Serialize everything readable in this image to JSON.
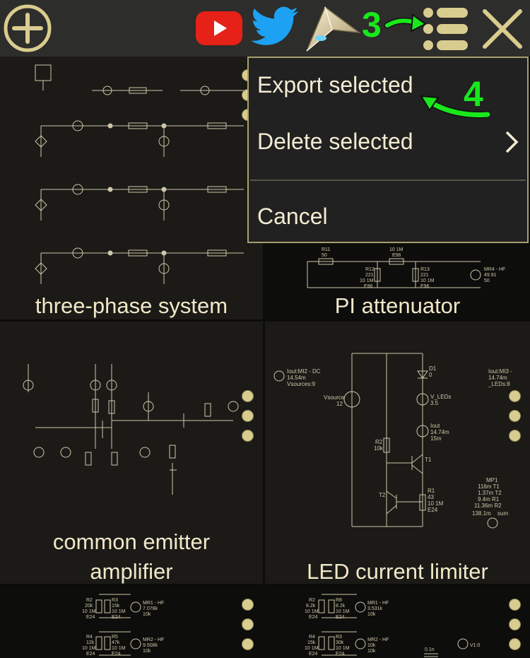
{
  "toolbar": {
    "add_icon": "plus-circle-icon",
    "youtube_icon": "youtube-icon",
    "twitter_icon": "twitter-icon",
    "app_icon": "app-logo-icon",
    "menu_icon": "list-menu-icon",
    "close_icon": "close-icon",
    "step3_label": "3"
  },
  "menu": {
    "items": [
      {
        "label": "Export selected"
      },
      {
        "label": "Delete selected"
      },
      {
        "label": "Cancel"
      }
    ],
    "step4_label": "4"
  },
  "tiles": [
    {
      "label": "three-phase system"
    },
    {
      "label": "PI attenuator"
    },
    {
      "label": "common emitter amplifier",
      "line1": "common emitter",
      "line2": "amplifier"
    },
    {
      "label": "LED current limiter"
    }
  ],
  "schematic_text": {
    "pi": {
      "r11": "R11",
      "r11v": "50",
      "r12": "R12",
      "r12v": "221",
      "r12t": "10  1M",
      "r12e": "E96",
      "r13": "R13",
      "r13v": "221",
      "r13t": "10  1M",
      "r13e": "E96",
      "r14": "10  1M",
      "r14e": "E96",
      "mr": "MR4 - HF",
      "mrv": "49.91",
      "mrv2": "50"
    },
    "led": {
      "meter": "Iout:MI2 - DC",
      "meterv": "14.54m",
      "metervs": "Vsources:9",
      "meter2": "Iout:MI3 -",
      "meter2v": "14.74m",
      "meter2b": "_LEDs:8",
      "d1": "D1",
      "d1v": "0",
      "vsrc": "Vsource",
      "vsrcv": "12",
      "vled": "V_LEDs",
      "vledv": "3.5",
      "iout": "Iout",
      "ioutv": "14.74m",
      "ioutv2": "15m",
      "r2": "R2",
      "r2v": "10k",
      "t1": "T1",
      "t2": "T2",
      "r1": "R1",
      "r1v": "43",
      "r1t": "10  1M",
      "r1e": "E24",
      "mp": "MP1",
      "mp_rows": [
        "116m  T1",
        "1.37m  T2",
        "9.4m  R1",
        "11.36m  R2"
      ],
      "sum": "138.1m",
      "sumlbl": "sum"
    },
    "bottom_left": {
      "r2": "R2",
      "r2v": "20k",
      "r2t": "10  1M",
      "r2e": "E24",
      "r3": "R3",
      "r3v": "15k",
      "r3t": "10  1M",
      "r3e": "E24",
      "mr1": "MR1 - HF",
      "mr1v": "7.078k",
      "mr1v2": "10k",
      "r4": "R4",
      "r4v": "12k",
      "r4t": "10  1M",
      "r4e": "E24",
      "r5": "R5",
      "r5v": "47k",
      "r5t": "10  1M",
      "r5e": "E24",
      "mr2": "MR2 - HF",
      "mr2v": "9.508k",
      "mr2v2": "10k"
    },
    "bottom_right": {
      "r2": "R2",
      "r2v": "8.2k",
      "r2t": "10  1M",
      "r2e": "E24",
      "r8": "R8",
      "r8v": "8.2k",
      "r8t": "10  1M",
      "r8e": "E24",
      "mr1": "MR1 - HF",
      "mr1v": "3.531k",
      "mr1v2": "10k",
      "r4": "R4",
      "r4v": "15k",
      "r4t": "10  1M",
      "r4e": "E24",
      "r3": "R3",
      "r3v": "30k",
      "r3t": "10  1M",
      "r3e": "E24",
      "mr2": "MR2 - HF",
      "mr2v": "10k",
      "mr2v2": "10k",
      "c": "0.1n",
      "v": "V1:0"
    }
  },
  "colors": {
    "toolbar_bg": "#2d2d2b",
    "accent": "#d9cc8f",
    "step_green": "#19e81c",
    "menu_bg": "#212121",
    "menu_border": "#a89e6c",
    "youtube_red": "#e62117",
    "twitter_blue": "#1da1f2"
  }
}
